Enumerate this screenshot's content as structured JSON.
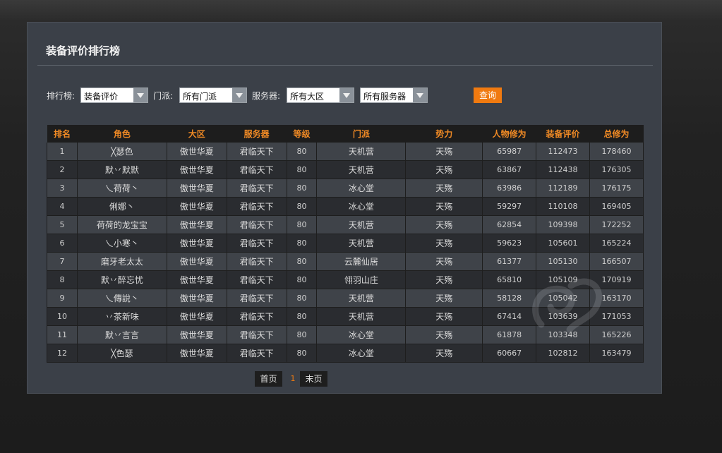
{
  "page": {
    "title": "装备评价排行榜"
  },
  "filters": {
    "rank_label": "排行榜:",
    "rank_value": "装备评价",
    "faction_label": "门派:",
    "faction_value": "所有门派",
    "server_label": "服务器:",
    "region_value": "所有大区",
    "server_value": "所有服务器",
    "query_label": "查询"
  },
  "table": {
    "headers": [
      "排名",
      "角色",
      "大区",
      "服务器",
      "等级",
      "门派",
      "势力",
      "人物修为",
      "装备评价",
      "总修为"
    ],
    "rows": [
      [
        "1",
        "╳瑟色",
        "傲世华夏",
        "君临天下",
        "80",
        "天机营",
        "天殇",
        "65987",
        "112473",
        "178460"
      ],
      [
        "2",
        "默丷默默",
        "傲世华夏",
        "君临天下",
        "80",
        "天机营",
        "天殇",
        "63867",
        "112438",
        "176305"
      ],
      [
        "3",
        "乀荷荷丶",
        "傲世华夏",
        "君临天下",
        "80",
        "冰心堂",
        "天殇",
        "63986",
        "112189",
        "176175"
      ],
      [
        "4",
        "俐娜丶",
        "傲世华夏",
        "君临天下",
        "80",
        "冰心堂",
        "天殇",
        "59297",
        "110108",
        "169405"
      ],
      [
        "5",
        "荷荷的龙宝宝",
        "傲世华夏",
        "君临天下",
        "80",
        "天机营",
        "天殇",
        "62854",
        "109398",
        "172252"
      ],
      [
        "6",
        "乀小寒丶",
        "傲世华夏",
        "君临天下",
        "80",
        "天机营",
        "天殇",
        "59623",
        "105601",
        "165224"
      ],
      [
        "7",
        "磨牙老太太",
        "傲世华夏",
        "君临天下",
        "80",
        "云麓仙居",
        "天殇",
        "61377",
        "105130",
        "166507"
      ],
      [
        "8",
        "默丷醉忘忧",
        "傲世华夏",
        "君临天下",
        "80",
        "翎羽山庄",
        "天殇",
        "65810",
        "105109",
        "170919"
      ],
      [
        "9",
        "乀傳說丶",
        "傲世华夏",
        "君临天下",
        "80",
        "天机营",
        "天殇",
        "58128",
        "105042",
        "163170"
      ],
      [
        "10",
        "丷茶新味",
        "傲世华夏",
        "君临天下",
        "80",
        "天机营",
        "天殇",
        "67414",
        "103639",
        "171053"
      ],
      [
        "11",
        "默丷言言",
        "傲世华夏",
        "君临天下",
        "80",
        "冰心堂",
        "天殇",
        "61878",
        "103348",
        "165226"
      ],
      [
        "12",
        "╳色瑟",
        "傲世华夏",
        "君临天下",
        "80",
        "冰心堂",
        "天殇",
        "60667",
        "102812",
        "163479"
      ]
    ]
  },
  "pager": {
    "first": "首页",
    "current": "1",
    "last": "末页"
  },
  "colors": {
    "accent": "#f07a10",
    "header_text": "#f08a25",
    "panel": "#3b4048"
  }
}
